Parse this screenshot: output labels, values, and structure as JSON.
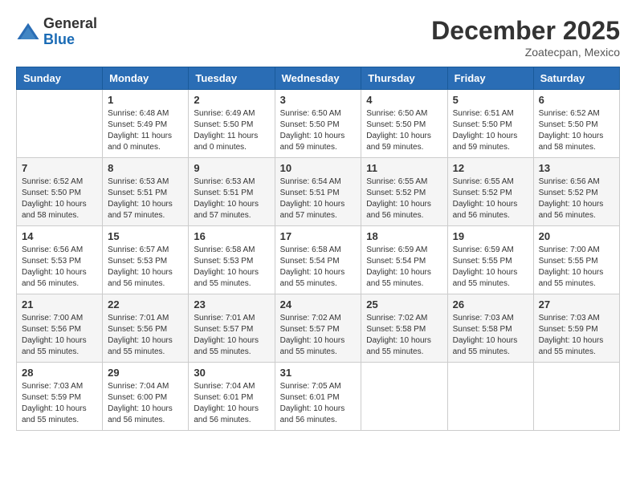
{
  "header": {
    "logo_line1": "General",
    "logo_line2": "Blue",
    "month": "December 2025",
    "location": "Zoatecpan, Mexico"
  },
  "days_of_week": [
    "Sunday",
    "Monday",
    "Tuesday",
    "Wednesday",
    "Thursday",
    "Friday",
    "Saturday"
  ],
  "weeks": [
    [
      {
        "day": "",
        "sunrise": "",
        "sunset": "",
        "daylight": ""
      },
      {
        "day": "1",
        "sunrise": "Sunrise: 6:48 AM",
        "sunset": "Sunset: 5:49 PM",
        "daylight": "Daylight: 11 hours and 0 minutes."
      },
      {
        "day": "2",
        "sunrise": "Sunrise: 6:49 AM",
        "sunset": "Sunset: 5:50 PM",
        "daylight": "Daylight: 11 hours and 0 minutes."
      },
      {
        "day": "3",
        "sunrise": "Sunrise: 6:50 AM",
        "sunset": "Sunset: 5:50 PM",
        "daylight": "Daylight: 10 hours and 59 minutes."
      },
      {
        "day": "4",
        "sunrise": "Sunrise: 6:50 AM",
        "sunset": "Sunset: 5:50 PM",
        "daylight": "Daylight: 10 hours and 59 minutes."
      },
      {
        "day": "5",
        "sunrise": "Sunrise: 6:51 AM",
        "sunset": "Sunset: 5:50 PM",
        "daylight": "Daylight: 10 hours and 59 minutes."
      },
      {
        "day": "6",
        "sunrise": "Sunrise: 6:52 AM",
        "sunset": "Sunset: 5:50 PM",
        "daylight": "Daylight: 10 hours and 58 minutes."
      }
    ],
    [
      {
        "day": "7",
        "sunrise": "Sunrise: 6:52 AM",
        "sunset": "Sunset: 5:50 PM",
        "daylight": "Daylight: 10 hours and 58 minutes."
      },
      {
        "day": "8",
        "sunrise": "Sunrise: 6:53 AM",
        "sunset": "Sunset: 5:51 PM",
        "daylight": "Daylight: 10 hours and 57 minutes."
      },
      {
        "day": "9",
        "sunrise": "Sunrise: 6:53 AM",
        "sunset": "Sunset: 5:51 PM",
        "daylight": "Daylight: 10 hours and 57 minutes."
      },
      {
        "day": "10",
        "sunrise": "Sunrise: 6:54 AM",
        "sunset": "Sunset: 5:51 PM",
        "daylight": "Daylight: 10 hours and 57 minutes."
      },
      {
        "day": "11",
        "sunrise": "Sunrise: 6:55 AM",
        "sunset": "Sunset: 5:52 PM",
        "daylight": "Daylight: 10 hours and 56 minutes."
      },
      {
        "day": "12",
        "sunrise": "Sunrise: 6:55 AM",
        "sunset": "Sunset: 5:52 PM",
        "daylight": "Daylight: 10 hours and 56 minutes."
      },
      {
        "day": "13",
        "sunrise": "Sunrise: 6:56 AM",
        "sunset": "Sunset: 5:52 PM",
        "daylight": "Daylight: 10 hours and 56 minutes."
      }
    ],
    [
      {
        "day": "14",
        "sunrise": "Sunrise: 6:56 AM",
        "sunset": "Sunset: 5:53 PM",
        "daylight": "Daylight: 10 hours and 56 minutes."
      },
      {
        "day": "15",
        "sunrise": "Sunrise: 6:57 AM",
        "sunset": "Sunset: 5:53 PM",
        "daylight": "Daylight: 10 hours and 56 minutes."
      },
      {
        "day": "16",
        "sunrise": "Sunrise: 6:58 AM",
        "sunset": "Sunset: 5:53 PM",
        "daylight": "Daylight: 10 hours and 55 minutes."
      },
      {
        "day": "17",
        "sunrise": "Sunrise: 6:58 AM",
        "sunset": "Sunset: 5:54 PM",
        "daylight": "Daylight: 10 hours and 55 minutes."
      },
      {
        "day": "18",
        "sunrise": "Sunrise: 6:59 AM",
        "sunset": "Sunset: 5:54 PM",
        "daylight": "Daylight: 10 hours and 55 minutes."
      },
      {
        "day": "19",
        "sunrise": "Sunrise: 6:59 AM",
        "sunset": "Sunset: 5:55 PM",
        "daylight": "Daylight: 10 hours and 55 minutes."
      },
      {
        "day": "20",
        "sunrise": "Sunrise: 7:00 AM",
        "sunset": "Sunset: 5:55 PM",
        "daylight": "Daylight: 10 hours and 55 minutes."
      }
    ],
    [
      {
        "day": "21",
        "sunrise": "Sunrise: 7:00 AM",
        "sunset": "Sunset: 5:56 PM",
        "daylight": "Daylight: 10 hours and 55 minutes."
      },
      {
        "day": "22",
        "sunrise": "Sunrise: 7:01 AM",
        "sunset": "Sunset: 5:56 PM",
        "daylight": "Daylight: 10 hours and 55 minutes."
      },
      {
        "day": "23",
        "sunrise": "Sunrise: 7:01 AM",
        "sunset": "Sunset: 5:57 PM",
        "daylight": "Daylight: 10 hours and 55 minutes."
      },
      {
        "day": "24",
        "sunrise": "Sunrise: 7:02 AM",
        "sunset": "Sunset: 5:57 PM",
        "daylight": "Daylight: 10 hours and 55 minutes."
      },
      {
        "day": "25",
        "sunrise": "Sunrise: 7:02 AM",
        "sunset": "Sunset: 5:58 PM",
        "daylight": "Daylight: 10 hours and 55 minutes."
      },
      {
        "day": "26",
        "sunrise": "Sunrise: 7:03 AM",
        "sunset": "Sunset: 5:58 PM",
        "daylight": "Daylight: 10 hours and 55 minutes."
      },
      {
        "day": "27",
        "sunrise": "Sunrise: 7:03 AM",
        "sunset": "Sunset: 5:59 PM",
        "daylight": "Daylight: 10 hours and 55 minutes."
      }
    ],
    [
      {
        "day": "28",
        "sunrise": "Sunrise: 7:03 AM",
        "sunset": "Sunset: 5:59 PM",
        "daylight": "Daylight: 10 hours and 55 minutes."
      },
      {
        "day": "29",
        "sunrise": "Sunrise: 7:04 AM",
        "sunset": "Sunset: 6:00 PM",
        "daylight": "Daylight: 10 hours and 56 minutes."
      },
      {
        "day": "30",
        "sunrise": "Sunrise: 7:04 AM",
        "sunset": "Sunset: 6:01 PM",
        "daylight": "Daylight: 10 hours and 56 minutes."
      },
      {
        "day": "31",
        "sunrise": "Sunrise: 7:05 AM",
        "sunset": "Sunset: 6:01 PM",
        "daylight": "Daylight: 10 hours and 56 minutes."
      },
      {
        "day": "",
        "sunrise": "",
        "sunset": "",
        "daylight": ""
      },
      {
        "day": "",
        "sunrise": "",
        "sunset": "",
        "daylight": ""
      },
      {
        "day": "",
        "sunrise": "",
        "sunset": "",
        "daylight": ""
      }
    ]
  ]
}
